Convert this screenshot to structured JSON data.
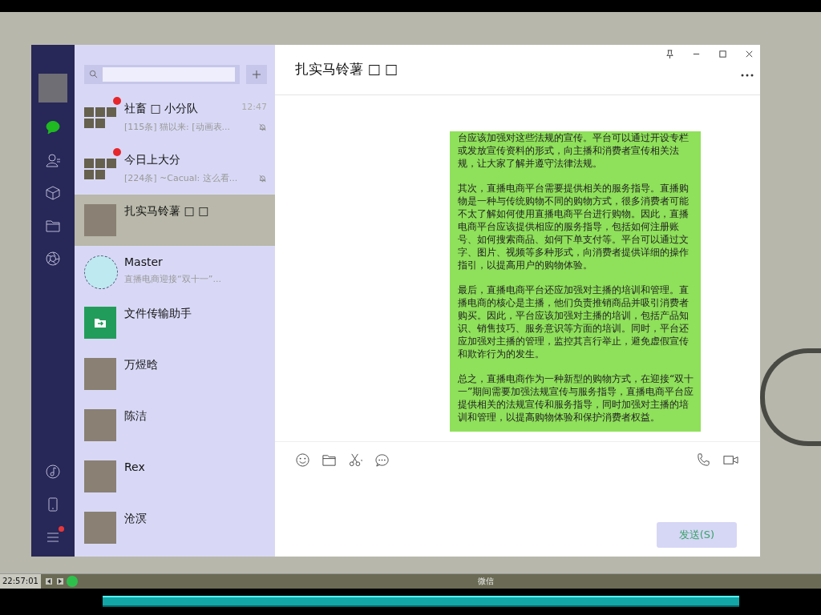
{
  "sidebar": {
    "items": [
      {
        "kind": "chat",
        "selected": true
      },
      {
        "kind": "contacts",
        "selected": false
      },
      {
        "kind": "box",
        "selected": false
      },
      {
        "kind": "folder",
        "selected": false
      },
      {
        "kind": "aperture",
        "selected": false
      }
    ],
    "bottom": [
      {
        "kind": "music",
        "badge": false
      },
      {
        "kind": "phone",
        "badge": false
      },
      {
        "kind": "menu",
        "badge": true
      }
    ]
  },
  "chats": [
    {
      "name": "社畜 □ 小分队",
      "preview": "[115条] 猫以来: [动画表...",
      "time": "12:47",
      "unread": true,
      "muted": true,
      "kind": "group",
      "selected": false
    },
    {
      "name": "今日上大分",
      "preview": "[224条] ~Cacual: 这么看...",
      "unread": true,
      "muted": true,
      "kind": "group",
      "selected": false
    },
    {
      "name": "扎实马铃薯 □ □",
      "unread": false,
      "muted": false,
      "kind": "photo",
      "selected": true
    },
    {
      "name": "Master",
      "preview": "直播电商迎接“双十一”...",
      "unread": false,
      "muted": false,
      "kind": "round",
      "selected": false
    },
    {
      "name": "文件传输助手",
      "unread": false,
      "muted": false,
      "kind": "file",
      "selected": false
    },
    {
      "name": "万煜晗",
      "unread": false,
      "muted": false,
      "kind": "photo",
      "selected": false
    },
    {
      "name": "陈洁",
      "unread": false,
      "muted": false,
      "kind": "photo",
      "selected": false
    },
    {
      "name": "Rex",
      "unread": false,
      "muted": false,
      "kind": "photo",
      "selected": false
    },
    {
      "name": "沧溟",
      "unread": false,
      "muted": false,
      "kind": "photo",
      "selected": false
    }
  ],
  "chat": {
    "title": "扎实马铃薯 □ □",
    "message": [
      "台应该加强对这些法规的宣传。平台可以通过开设专栏或发放宣传资料的形式，向主播和消费者宣传相关法规，让大家了解并遵守法律法规。",
      "其次，直播电商平台需要提供相关的服务指导。直播购物是一种与传统购物不同的购物方式，很多消费者可能不太了解如何使用直播电商平台进行购物。因此，直播电商平台应该提供相应的服务指导，包括如何注册账号、如何搜索商品、如何下单支付等。平台可以通过文字、图片、视频等多种形式，向消费者提供详细的操作指引，以提高用户的购物体验。",
      "最后，直播电商平台还应加强对主播的培训和管理。直播电商的核心是主播，他们负责推销商品并吸引消费者购买。因此，平台应该加强对主播的培训，包括产品知识、销售技巧、服务意识等方面的培训。同时，平台还应加强对主播的管理，监控其言行举止，避免虚假宣传和欺诈行为的发生。",
      "总之，直播电商作为一种新型的购物方式，在迎接“双十一”期间需要加强法规宣传与服务指导，直播电商平台应提供相关的法规宣传和服务指导，同时加强对主播的培训和管理，以提高购物体验和保护消费者权益。"
    ],
    "send": "发送(S)"
  },
  "taskbar": {
    "time": "22:57:01",
    "title": "微信"
  }
}
